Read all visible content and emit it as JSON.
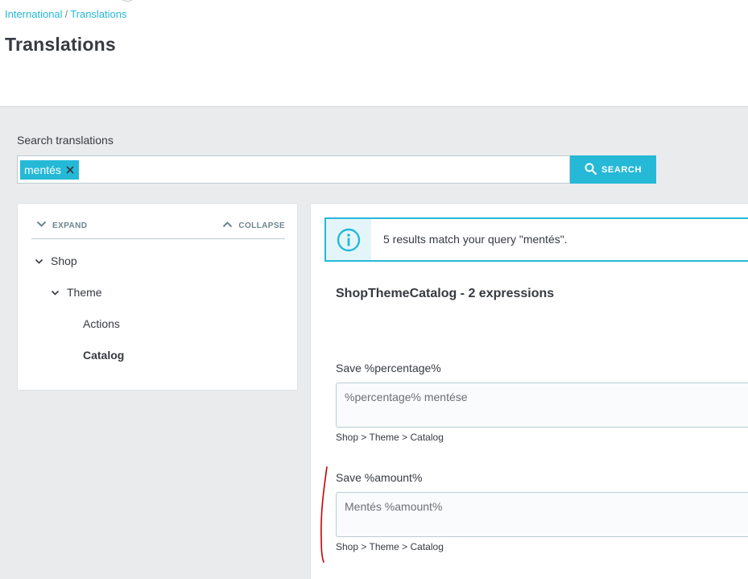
{
  "breadcrumb": {
    "parent": "International",
    "separator": "/",
    "current": "Translations"
  },
  "page": {
    "title": "Translations"
  },
  "search": {
    "label": "Search translations",
    "tag_value": "mentés",
    "tag_remove_icon": "close-icon",
    "button_label": "SEARCH",
    "button_icon": "search-icon"
  },
  "tree": {
    "expand_label": "EXPAND",
    "collapse_label": "COLLAPSE",
    "items": [
      {
        "label": "Shop",
        "state": "expanded"
      },
      {
        "label": "Theme",
        "state": "expanded"
      },
      {
        "label": "Actions",
        "state": "leaf"
      },
      {
        "label": "Catalog",
        "state": "selected"
      }
    ]
  },
  "results": {
    "alert_text": "5 results match your query \"mentés\".",
    "alert_icon": "info-icon",
    "section_title": "ShopThemeCatalog - 2 expressions",
    "fields": [
      {
        "label": "Save %percentage%",
        "value": "%percentage% mentése",
        "path": "Shop > Theme > Catalog"
      },
      {
        "label": "Save %amount%",
        "value": "Mentés %amount%",
        "path": "Shop > Theme > Catalog"
      }
    ]
  },
  "colors": {
    "accent": "#25b9d7",
    "text": "#363a41",
    "background": "#eaebec",
    "annotation": "#cc0000"
  }
}
